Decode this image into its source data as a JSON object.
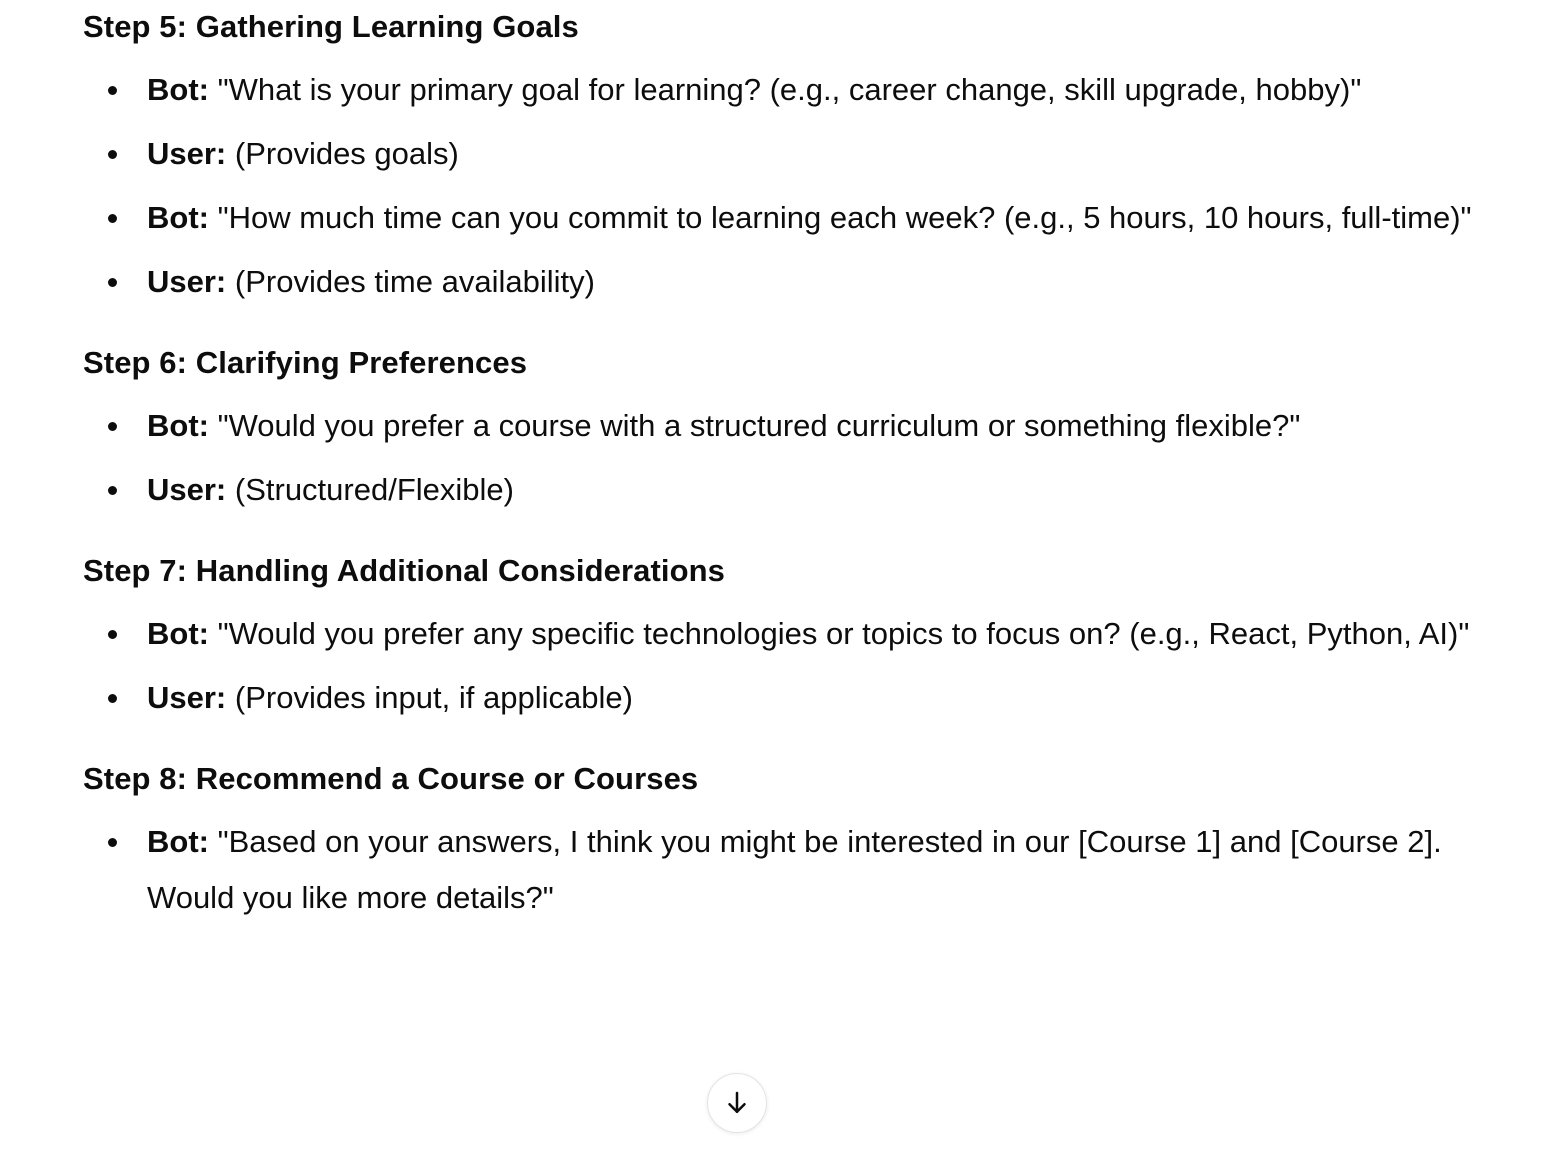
{
  "steps": [
    {
      "heading": "Step 5: Gathering Learning Goals",
      "items": [
        {
          "speaker": "Bot:",
          "text": " \"What is your primary goal for learning? (e.g., career change, skill upgrade, hobby)\""
        },
        {
          "speaker": "User:",
          "text": " (Provides goals)"
        },
        {
          "speaker": "Bot:",
          "text": " \"How much time can you commit to learning each week? (e.g., 5 hours, 10 hours, full-time)\""
        },
        {
          "speaker": "User:",
          "text": " (Provides time availability)"
        }
      ]
    },
    {
      "heading": "Step 6: Clarifying Preferences",
      "items": [
        {
          "speaker": "Bot:",
          "text": " \"Would you prefer a course with a structured curriculum or something flexible?\""
        },
        {
          "speaker": "User:",
          "text": " (Structured/Flexible)"
        }
      ]
    },
    {
      "heading": "Step 7: Handling Additional Considerations",
      "items": [
        {
          "speaker": "Bot:",
          "text": " \"Would you prefer any specific technologies or topics to focus on? (e.g., React, Python, AI)\""
        },
        {
          "speaker": "User:",
          "text": " (Provides input, if applicable)"
        }
      ]
    },
    {
      "heading": "Step 8: Recommend a Course or Courses",
      "items": [
        {
          "speaker": "Bot:",
          "text": " \"Based on your answers, I think you might be interested in our [Course 1] and [Course 2]. Would you like more details?\""
        }
      ]
    }
  ],
  "scroll_button": {
    "icon": "arrow-down-icon"
  }
}
